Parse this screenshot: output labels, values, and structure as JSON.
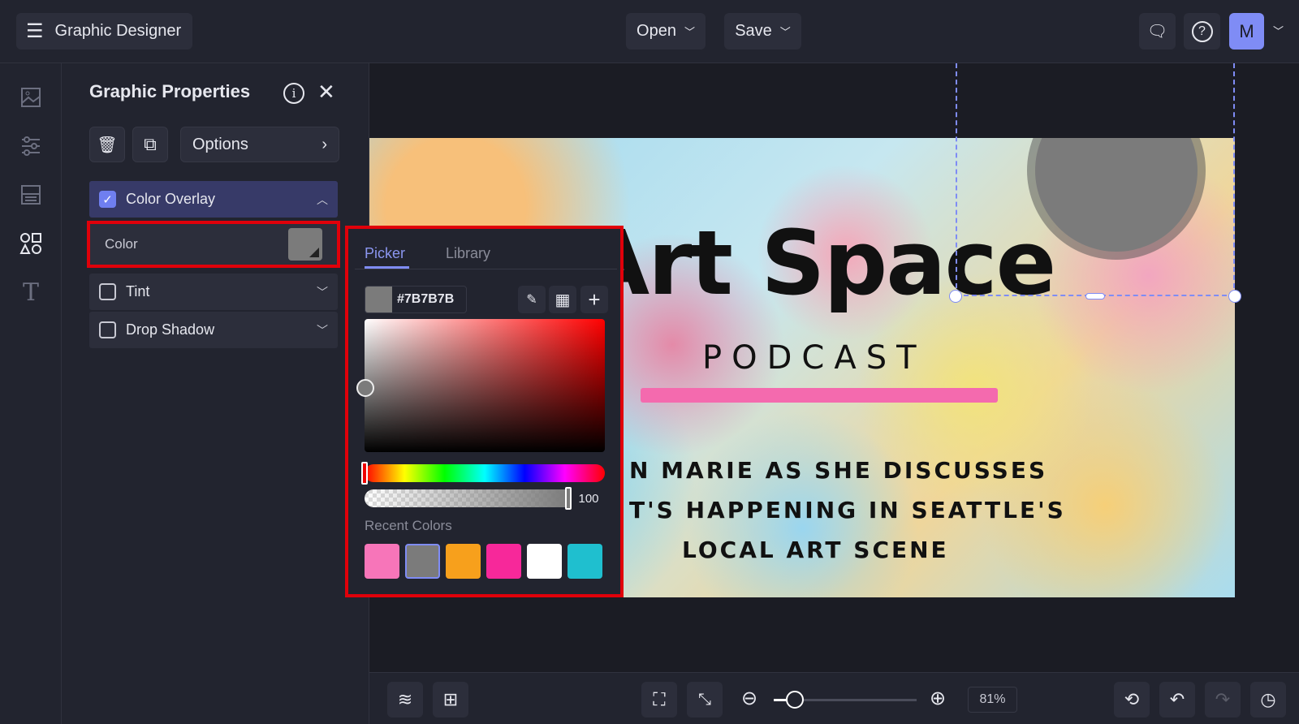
{
  "app": {
    "title": "Graphic Designer",
    "open_label": "Open",
    "save_label": "Save",
    "avatar_initial": "M"
  },
  "panel": {
    "title": "Graphic Properties",
    "options_label": "Options",
    "sections": [
      {
        "label": "Color Overlay",
        "checked": true
      },
      {
        "label": "Tint",
        "checked": false
      },
      {
        "label": "Drop Shadow",
        "checked": false
      }
    ],
    "color_label": "Color",
    "color_value": "#7B7B7B"
  },
  "picker": {
    "tabs": [
      "Picker",
      "Library"
    ],
    "active_tab": "Picker",
    "hex": "#7B7B7B",
    "opacity": "100",
    "hue": 0,
    "recent_label": "Recent Colors",
    "recent_colors": [
      "#f775b9",
      "#7b7b7b",
      "#f7a01c",
      "#f7289a",
      "#ffffff",
      "#1fbfcf"
    ]
  },
  "poster": {
    "title": "Art Space",
    "subtitle": "PODCAST",
    "lines": [
      "N MARIE AS SHE DISCUSSES",
      "T'S HAPPENING IN SEATTLE'S",
      "LOCAL ART SCENE"
    ]
  },
  "zoom": {
    "label": "81%",
    "value": 81
  },
  "colors": {
    "accent": "#7f8cf5",
    "highlight": "#e0000a"
  }
}
